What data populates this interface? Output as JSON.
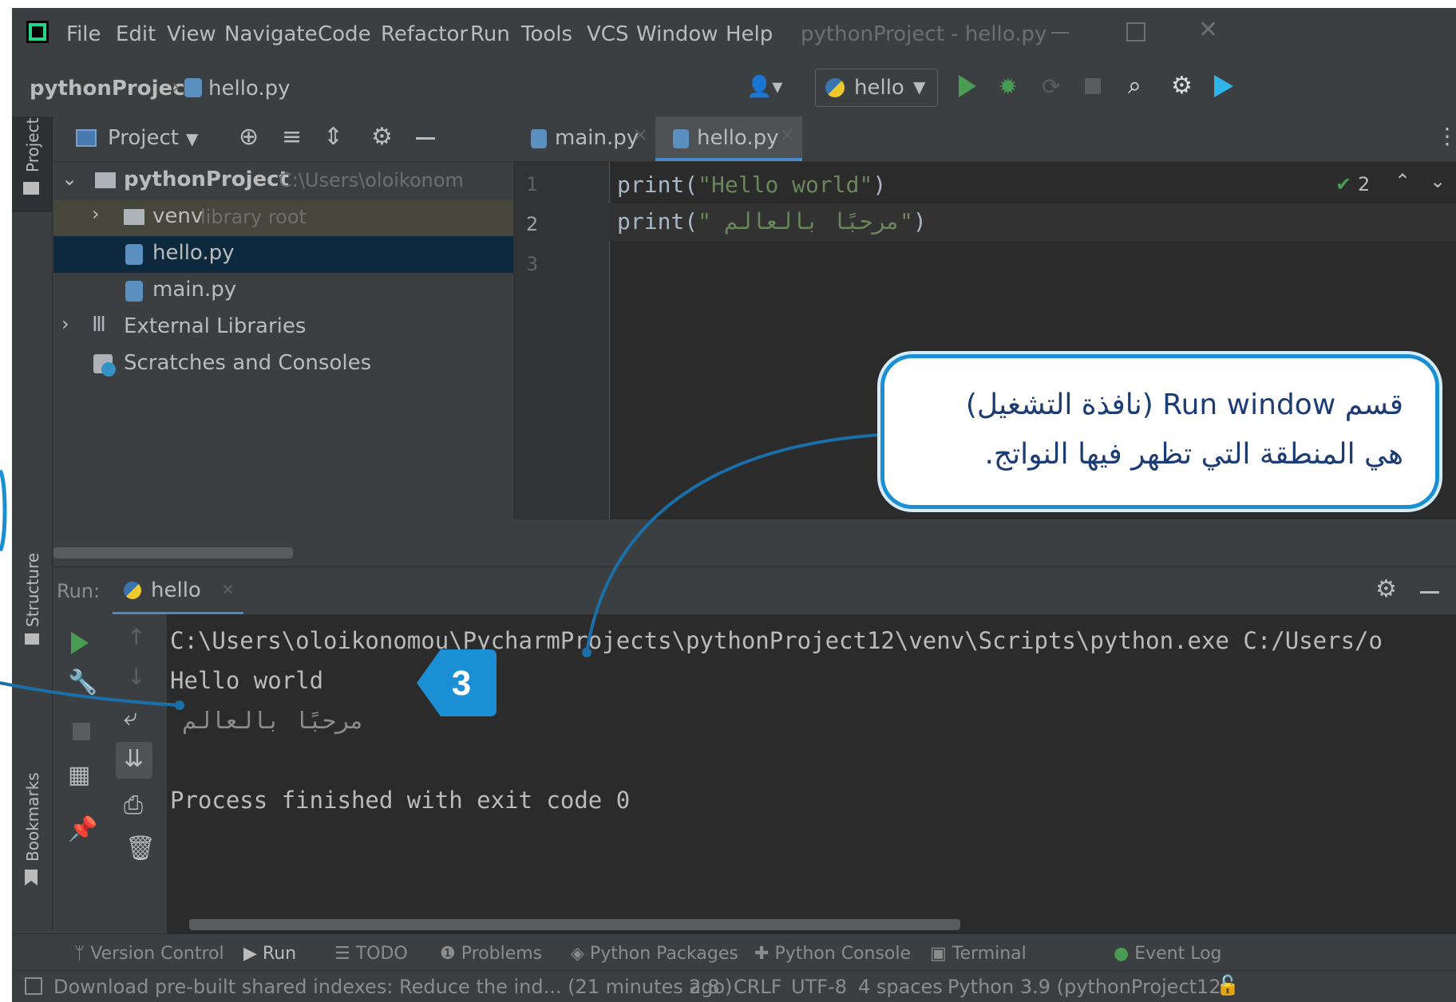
{
  "menubar": {
    "items": [
      "File",
      "Edit",
      "View",
      "Navigate",
      "Code",
      "Refactor",
      "Run",
      "Tools",
      "VCS",
      "Window",
      "Help"
    ],
    "title": "pythonProject - hello.py"
  },
  "navbar": {
    "project": "pythonProject",
    "file": "hello.py",
    "run_config": "hello"
  },
  "project_panel": {
    "title": "Project",
    "root_name": "pythonProject",
    "root_path": "C:\\Users\\oloikonom",
    "venv": "venv",
    "venv_hint": "library root",
    "files": [
      "hello.py",
      "main.py"
    ],
    "external": "External Libraries",
    "scratches": "Scratches and Consoles"
  },
  "side_stripe": {
    "project": "Project",
    "structure": "Structure",
    "bookmarks": "Bookmarks"
  },
  "editor": {
    "tabs": [
      "main.py",
      "hello.py"
    ],
    "line_numbers": [
      "1",
      "2",
      "3"
    ],
    "line1_prefix": "print(",
    "line1_str": "\"Hello world\"",
    "line1_suffix": ")",
    "line2_prefix": "print(",
    "line2_str": "\" مرحبًا بالعالم\"",
    "line2_suffix": ")",
    "inspection_count": "2"
  },
  "run_panel": {
    "label": "Run:",
    "tab": "hello",
    "lines": [
      "C:\\Users\\oloikonomou\\PycharmProjects\\pythonProject12\\venv\\Scripts\\python.exe C:/Users/o",
      "Hello world",
      "مرحبًا بالعالم",
      "",
      "Process finished with exit code 0"
    ]
  },
  "tool_windows": [
    "Version Control",
    "Run",
    "TODO",
    "Problems",
    "Python Packages",
    "Python Console",
    "Terminal",
    "Event Log"
  ],
  "status": {
    "message": "Download pre-built shared indexes: Reduce the ind... (21 minutes ago)",
    "position": "2:8",
    "line_sep": "CRLF",
    "encoding": "UTF-8",
    "indent": "4 spaces",
    "interpreter": "Python 3.9 (pythonProject12)"
  },
  "callout": {
    "line1": "قسم Run window (نافذة التشغيل)",
    "line2": "هي المنطقة التي تظهر فيها النواتج."
  },
  "badge_number": "3",
  "colors": {
    "accent": "#1b8fd4",
    "run_green": "#499c54",
    "string_green": "#6a8759"
  }
}
